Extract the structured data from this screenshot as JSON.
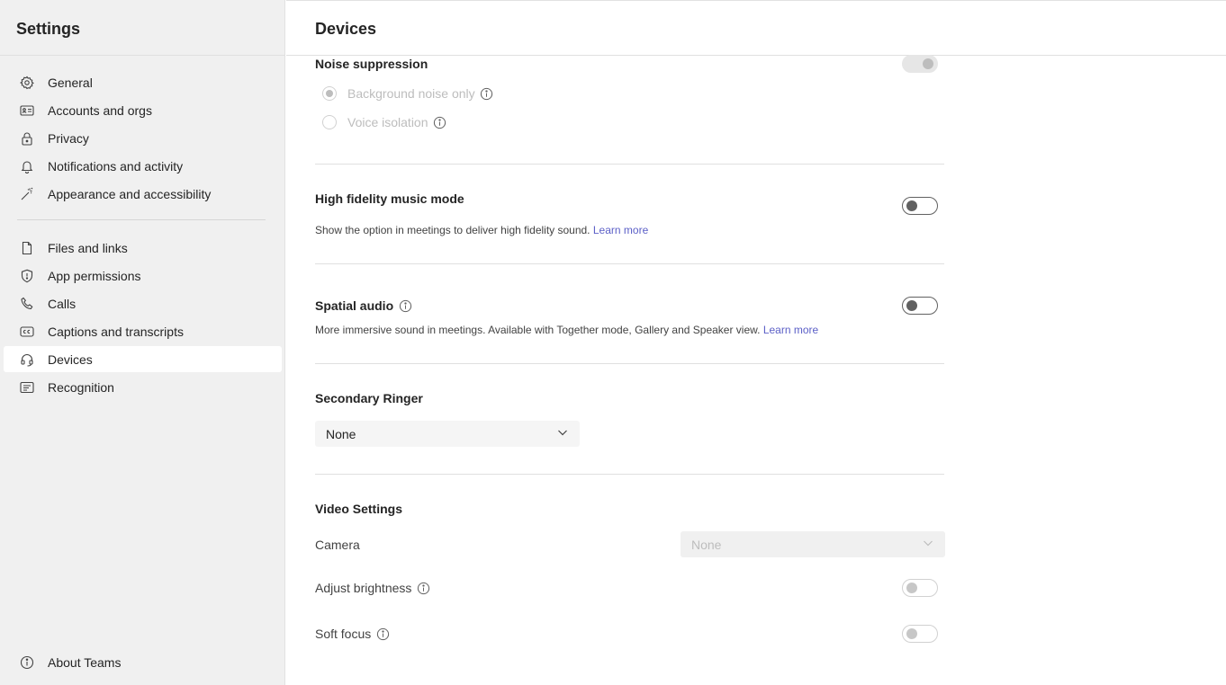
{
  "sidebar": {
    "title": "Settings",
    "items": [
      {
        "label": "General",
        "icon": "gear-icon"
      },
      {
        "label": "Accounts and orgs",
        "icon": "id-card-icon"
      },
      {
        "label": "Privacy",
        "icon": "lock-icon"
      },
      {
        "label": "Notifications and activity",
        "icon": "bell-icon"
      },
      {
        "label": "Appearance and accessibility",
        "icon": "magic-wand-icon"
      },
      {
        "label": "Files and links",
        "icon": "document-icon"
      },
      {
        "label": "App permissions",
        "icon": "shield-icon"
      },
      {
        "label": "Calls",
        "icon": "phone-icon"
      },
      {
        "label": "Captions and transcripts",
        "icon": "closed-captions-icon"
      },
      {
        "label": "Devices",
        "icon": "headset-icon",
        "active": true
      },
      {
        "label": "Recognition",
        "icon": "recognition-icon"
      }
    ],
    "about": {
      "label": "About Teams",
      "icon": "info-icon"
    }
  },
  "main": {
    "title": "Devices",
    "noise_suppression": {
      "title": "Noise suppression",
      "options": [
        {
          "label": "Background noise only",
          "selected": true
        },
        {
          "label": "Voice isolation",
          "selected": false
        }
      ]
    },
    "hifi": {
      "title": "High fidelity music mode",
      "desc": "Show the option in meetings to deliver high fidelity sound.",
      "link": "Learn more"
    },
    "spatial": {
      "title": "Spatial audio",
      "desc": "More immersive sound in meetings. Available with Together mode, Gallery and Speaker view.",
      "link": "Learn more"
    },
    "ringer": {
      "title": "Secondary Ringer",
      "value": "None"
    },
    "video": {
      "title": "Video Settings",
      "camera_label": "Camera",
      "camera_value": "None",
      "brightness_label": "Adjust brightness",
      "soft_focus_label": "Soft focus"
    }
  }
}
